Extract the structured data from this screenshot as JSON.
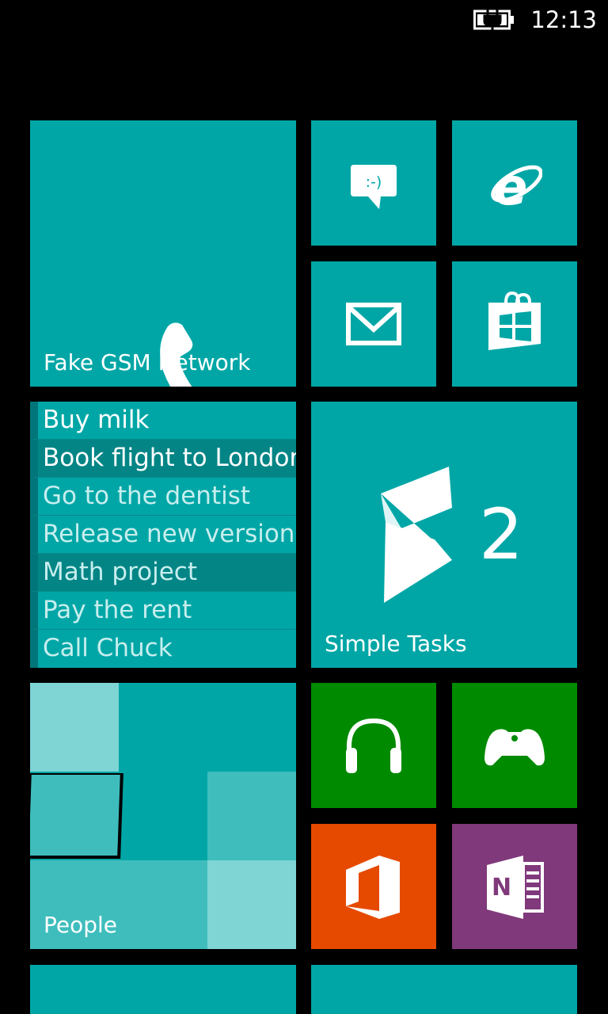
{
  "status_bar": {
    "time": "12:13",
    "battery_icon": "battery-charging-icon"
  },
  "tiles": {
    "phone": {
      "label": "Fake GSM Network",
      "icon": "phone-icon"
    },
    "messaging": {
      "icon": "messaging-icon"
    },
    "browser": {
      "icon": "internet-explorer-icon"
    },
    "mail": {
      "icon": "mail-icon"
    },
    "store": {
      "icon": "store-icon"
    },
    "simple_tasks": {
      "label": "Simple Tasks",
      "count": "2",
      "icon": "simple-tasks-logo-icon"
    },
    "music": {
      "icon": "headphones-icon"
    },
    "games": {
      "icon": "gamepad-icon"
    },
    "office": {
      "icon": "office-icon"
    },
    "onenote": {
      "icon": "onenote-icon"
    },
    "people": {
      "label": "People"
    }
  },
  "tasks": [
    {
      "text": "Buy milk"
    },
    {
      "text": "Book flight to London"
    },
    {
      "text": "Go to the dentist"
    },
    {
      "text": "Release new version"
    },
    {
      "text": "Math project"
    },
    {
      "text": "Pay the rent"
    },
    {
      "text": "Call Chuck"
    }
  ],
  "colors": {
    "accent": "#00A6A6",
    "music": "#008A00",
    "office": "#E64A00",
    "onenote": "#80397B",
    "background": "#000000"
  }
}
